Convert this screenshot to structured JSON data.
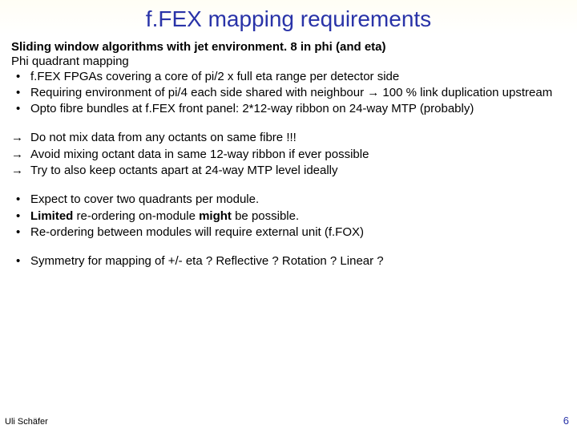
{
  "title": "f.FEX mapping requirements",
  "intro_bold": "Sliding window algorithms with jet environment. 8 in phi (and eta)",
  "intro_plain": "Phi quadrant mapping",
  "bullets1": [
    "f.FEX FPGAs covering a core of pi/2 x full eta range per detector side",
    "Requiring environment of pi/4 each side shared with neighbour → 100 % link duplication upstream",
    "Opto fibre bundles at f.FEX front panel: 2*12-way ribbon on 24-way MTP (probably)"
  ],
  "arrows": [
    "Do not mix data from any octants on same fibre !!!",
    "Avoid mixing octant data in same 12-way ribbon if ever possible",
    "Try to also keep octants apart at 24-way MTP level ideally"
  ],
  "bullets2_a_pre": "Expect to cover two quadrants per module.",
  "bullets2_b_bold1": "Limited",
  "bullets2_b_mid": " re-ordering on-module ",
  "bullets2_b_bold2": "might",
  "bullets2_b_post": " be possible.",
  "bullets2_c": "Re-ordering between modules will require external unit (f.FOX)",
  "bullets3": "Symmetry for mapping of +/- eta ? Reflective ? Rotation ? Linear ?",
  "footer_author": "Uli Schäfer",
  "footer_page": "6"
}
